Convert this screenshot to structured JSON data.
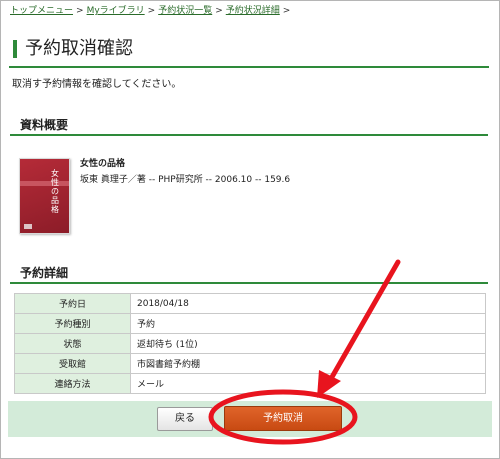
{
  "breadcrumb": {
    "items": [
      "トップメニュー",
      "Myライブラリ",
      "予約状況一覧",
      "予約状況詳細"
    ],
    "separator": ">"
  },
  "page": {
    "title": "予約取消確認",
    "intro": "取消す予約情報を確認してください。"
  },
  "sections": {
    "summary_heading": "資料概要",
    "detail_heading": "予約詳細"
  },
  "book": {
    "title": "女性の品格",
    "meta": "坂東 眞理子／著 -- PHP研究所 -- 2006.10 -- 159.6",
    "cover_title": "女性の品格"
  },
  "detail": {
    "rows": [
      {
        "label": "予約日",
        "value": "2018/04/18"
      },
      {
        "label": "予約種別",
        "value": "予約"
      },
      {
        "label": "状態",
        "value": "返却待ち (1位)"
      },
      {
        "label": "受取館",
        "value": "市図書館予約棚"
      },
      {
        "label": "連絡方法",
        "value": "メール"
      }
    ]
  },
  "buttons": {
    "back": "戻る",
    "cancel_reservation": "予約取消"
  },
  "colors": {
    "accent_green": "#2e8a3a",
    "button_bar": "#d3ebd9",
    "cancel_button": "#c84a12",
    "annotation_red": "#e8141e"
  },
  "icons": {
    "book_cover": "book-cover-image",
    "annotation_arrow": "red-arrow-icon",
    "annotation_circle": "red-ellipse-highlight"
  }
}
